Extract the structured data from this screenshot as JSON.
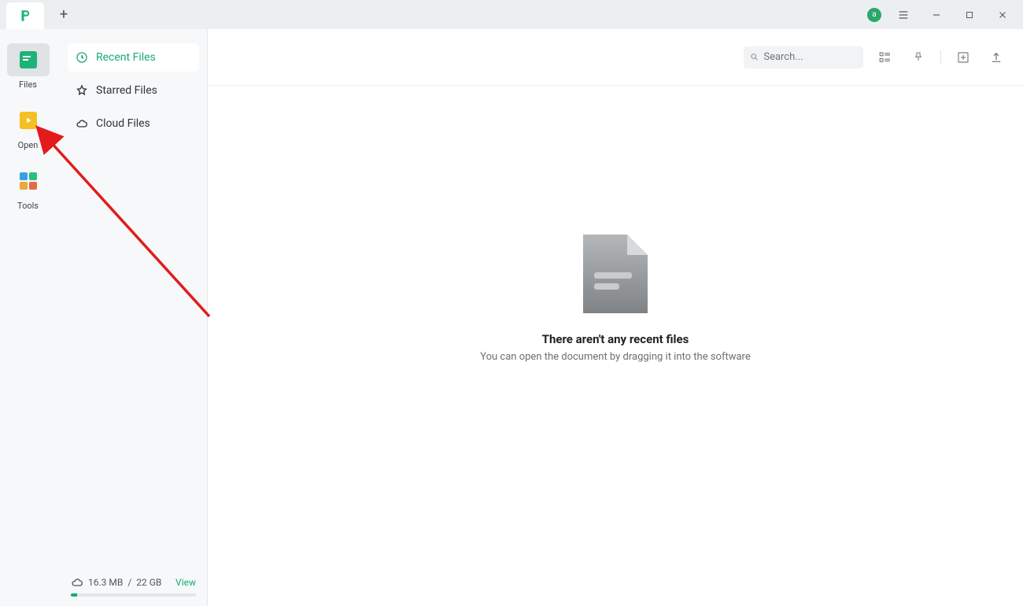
{
  "titlebar": {
    "avatar_initial": "a",
    "new_tab_tooltip": "+"
  },
  "rail": {
    "items": [
      {
        "label": "Files",
        "active": true
      },
      {
        "label": "Open",
        "active": false
      },
      {
        "label": "Tools",
        "active": false
      }
    ]
  },
  "sidebar": {
    "items": [
      {
        "label": "Recent Files",
        "active": true
      },
      {
        "label": "Starred Files",
        "active": false
      },
      {
        "label": "Cloud Files",
        "active": false
      }
    ]
  },
  "storage": {
    "used": "16.3 MB",
    "total": "22 GB",
    "view_label": "View",
    "percent": 5
  },
  "toolbar": {
    "search_placeholder": "Search..."
  },
  "empty_state": {
    "title": "There aren't any recent files",
    "subtitle": "You can open the document by dragging it into the software"
  }
}
